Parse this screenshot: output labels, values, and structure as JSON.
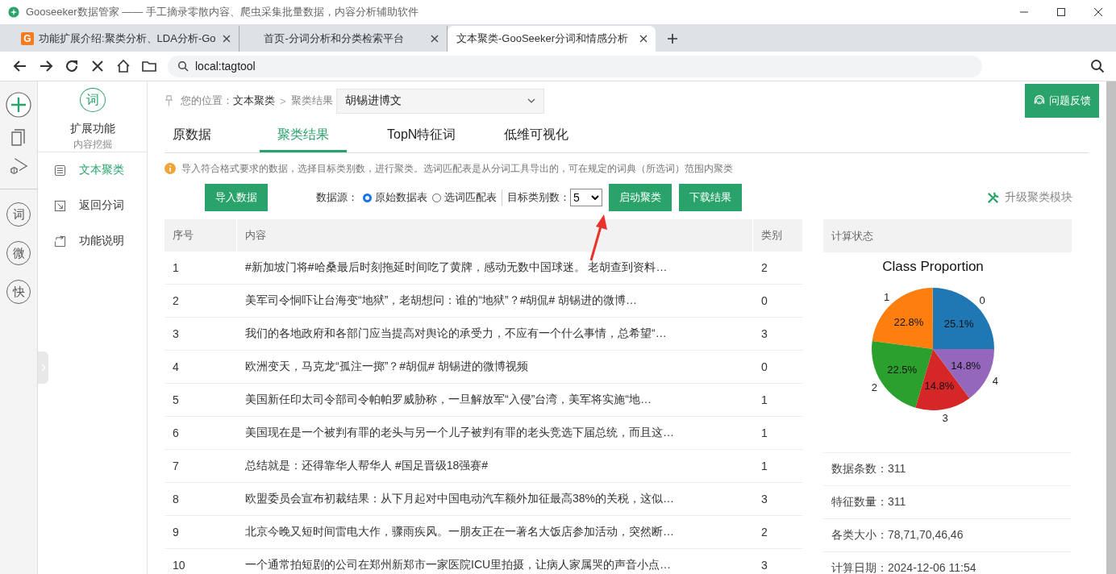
{
  "window": {
    "title": "Gooseeker数据管家 —— 手工摘录零散内容、爬虫采集批量数据，内容分析辅助软件"
  },
  "browser_tabs": [
    {
      "label": "功能扩展介绍:聚类分析、LDA分析-Go",
      "favicon": "G",
      "selected": false
    },
    {
      "label": "首页-分词分析和分类检索平台",
      "selected": false
    },
    {
      "label": "文本聚类-GooSeeker分词和情感分析",
      "selected": true
    }
  ],
  "address_bar": {
    "url": "local:tagtool"
  },
  "rail_badges": [
    "词",
    "微",
    "快"
  ],
  "sidebar": {
    "badge": "词",
    "title": "扩展功能",
    "subtitle": "内容挖掘",
    "items": [
      {
        "label": "文本聚类",
        "selected": true,
        "kind": "list"
      },
      {
        "label": "返回分词",
        "selected": false,
        "kind": "back"
      },
      {
        "label": "功能说明",
        "selected": false,
        "kind": "help"
      }
    ]
  },
  "breadcrumb": {
    "label": "您的位置：",
    "current": "文本聚类",
    "separator": ">",
    "page": "聚类结果",
    "dropdown": "胡锡进博文"
  },
  "feedback_button": "问题反馈",
  "tabs": [
    {
      "label": "原数据",
      "selected": false
    },
    {
      "label": "聚类结果",
      "selected": true
    },
    {
      "label": "TopN特征词",
      "selected": false
    },
    {
      "label": "低维可视化",
      "selected": false
    }
  ],
  "notice": "导入符合格式要求的数据，选择目标类别数，进行聚类。选词匹配表是从分词工具导出的，可在规定的词典（所选词）范围内聚类",
  "toolbar": {
    "import_button": "导入数据",
    "source_label": "数据源：",
    "sources": [
      {
        "label": "原始数据表",
        "selected": true
      },
      {
        "label": "选词匹配表",
        "selected": false
      }
    ],
    "target_label": "目标类别数：",
    "target_value": "5",
    "start_button": "启动聚类",
    "download_button": "下载结果",
    "upgrade_link": "升级聚类模块"
  },
  "table": {
    "columns": [
      "序号",
      "内容",
      "类别"
    ],
    "rows": [
      [
        "1",
        "#新加坡门将#哈桑最后时刻拖延时间吃了黄牌，感动无数中国球迷。 老胡查到资料…",
        "2"
      ],
      [
        "2",
        "美军司令恫吓让台海变“地狱”，老胡想问：谁的“地狱”？#胡侃# 胡锡进的微博…",
        "0"
      ],
      [
        "3",
        "我们的各地政府和各部门应当提高对舆论的承受力，不应有一个什么事情，总希望“…",
        "3"
      ],
      [
        "4",
        "欧洲变天，马克龙“孤注一掷”？#胡侃# 胡锡进的微博视频",
        "0"
      ],
      [
        "5",
        "美国新任印太司令部司令帕帕罗威胁称，一旦解放军“入侵”台湾，美军将实施“地…",
        "1"
      ],
      [
        "6",
        "美国现在是一个被判有罪的老头与另一个儿子被判有罪的老头竞选下届总统，而且这…",
        "1"
      ],
      [
        "7",
        "总结就是：还得靠华人帮华人 #国足晋级18强赛#",
        "1"
      ],
      [
        "8",
        "欧盟委员会宣布初裁结果：从下月起对中国电动汽车额外加征最高38%的关税，这似…",
        "3"
      ],
      [
        "9",
        "北京今晚又短时间雷电大作，骤雨疾风。一朋友正在一著名大饭店参加活动，突然断…",
        "2"
      ],
      [
        "10",
        "一个通常拍短剧的公司在郑州新郑市一家医院ICU里拍摄，让病人家属哭的声音小点…",
        "3"
      ]
    ]
  },
  "status_panel": {
    "title": "计算状态",
    "chart_data": {
      "type": "pie",
      "title": "Class Proportion",
      "categories": [
        "0",
        "1",
        "2",
        "3",
        "4"
      ],
      "values": [
        25.1,
        22.8,
        22.5,
        14.8,
        14.8
      ],
      "value_labels": [
        "25.1%",
        "22.8%",
        "22.5%",
        "14.8%",
        "14.8%"
      ]
    },
    "stats": [
      "数据条数：311",
      "特征数量：311",
      "各类大小：78,71,70,46,46",
      "计算日期：2024-12-06 11:54"
    ]
  }
}
